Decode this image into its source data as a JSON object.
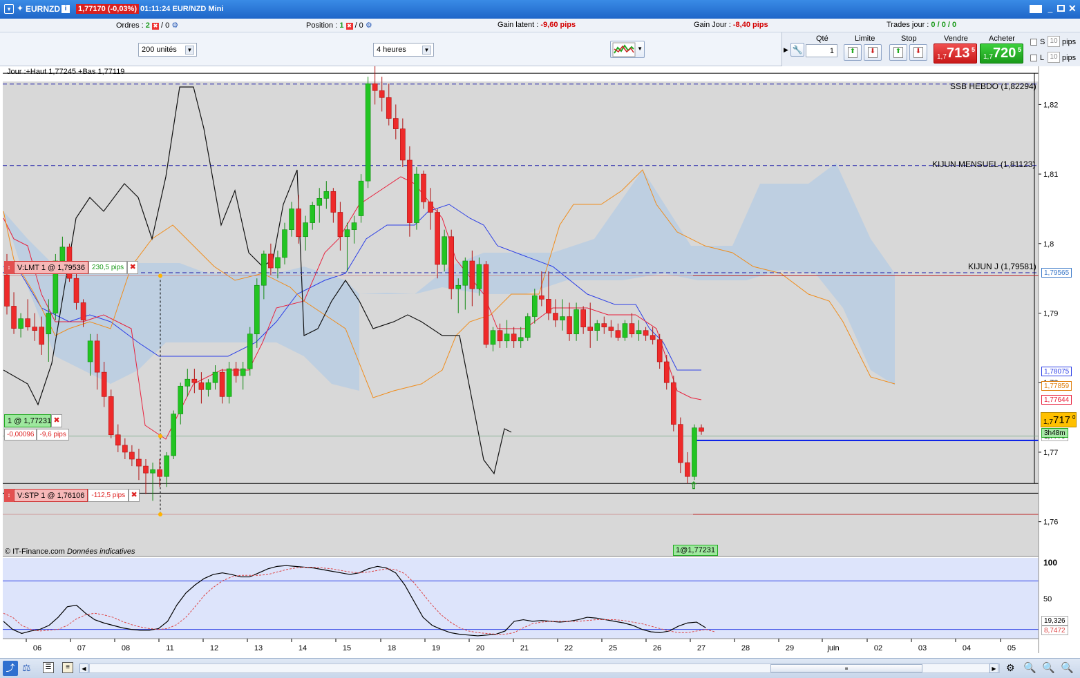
{
  "title": {
    "symbol": "EURNZD",
    "price_change": "1,77170 (-0,03%)",
    "clock_instrument": "01:11:24 EUR/NZD Mini"
  },
  "infobar": {
    "orders_label": "Ordres :",
    "orders_count": "2",
    "orders_sep": "/ 0",
    "position_label": "Position :",
    "position_count": "1",
    "position_sep": "/ 0",
    "latent_label": "Gain latent :",
    "latent_value": "-9,60 pips",
    "day_label": "Gain Jour :",
    "day_value": "-8,40 pips",
    "trades_label": "Trades jour :",
    "trades_value": "0 / 0 / 0"
  },
  "controls": {
    "units": "200 unités",
    "timeframe": "4 heures",
    "qty_label": "Qté",
    "qty_value": "1",
    "limit_label": "Limite",
    "stop_label": "Stop",
    "sell_label": "Vendre",
    "buy_label": "Acheter",
    "sell_price_small": "1,7",
    "sell_price_big": "713",
    "sell_price_sup": "5",
    "buy_price_small": "1,7",
    "buy_price_big": "720",
    "buy_price_sup": "5",
    "s_label": "S",
    "l_label": "L",
    "s_value": "10",
    "l_value": "10",
    "pips": "pips"
  },
  "chart": {
    "info": "Jour :+Haut 1,77245 +Bas 1,77119",
    "lines": {
      "ssb": "SSB HEBDO (1,82294)",
      "kijun_m": "KIJUN MENSUEL (1,81123)",
      "kijun_j": "KIJUN J (1,79581)"
    },
    "orders": {
      "lmt": {
        "label": "V:LMT  1 @ 1,79536",
        "pips": "230,5 pips"
      },
      "stp": {
        "label": "V:STP  1 @ 1,76106",
        "pips": "-112,5 pips"
      },
      "pos": {
        "label": "1 @ 1,77231",
        "pl": "-0,00096",
        "pips": "-9,6 pips"
      }
    },
    "fill_label": "1@1,77231",
    "timer": "3h48m",
    "source": "© IT-Finance.com",
    "source_note": "Données indicatives",
    "price_axis": [
      "1,82",
      "1,81",
      "1,8",
      "1,79",
      "1,78",
      "1,77",
      "1,76"
    ],
    "right_labels": {
      "l1": "1,79565",
      "l2": "1,78075",
      "l3": "1,77859",
      "l4": "1,77644",
      "cur_small": "1,7",
      "cur_big": "717",
      "cur_sup": "0",
      "l5": "1,7770"
    },
    "osc_axis": [
      "100",
      "50"
    ],
    "osc_labels": {
      "k": "19,326",
      "d": "8,7472"
    },
    "x_axis": [
      "06",
      "07",
      "08",
      "11",
      "12",
      "13",
      "14",
      "15",
      "18",
      "19",
      "20",
      "21",
      "22",
      "25",
      "26",
      "27",
      "28",
      "29",
      "juin",
      "02",
      "03",
      "04",
      "05"
    ],
    "colors": {
      "bull": "#22c422",
      "bear": "#ee2a2a",
      "tenkan": "#e8203c",
      "kijun": "#2b3ee6",
      "chikou": "#111111",
      "ssa": "#f08c1a",
      "ssb_cloud": "#6aa7e6"
    }
  },
  "chart_data": {
    "type": "candlestick",
    "symbol": "EURNZD",
    "timeframe": "4 heures",
    "ylim": [
      1.755,
      1.8255
    ],
    "candles": [
      [
        1.7955,
        1.7985,
        1.7898,
        1.791
      ],
      [
        1.791,
        1.793,
        1.787,
        1.7878
      ],
      [
        1.7878,
        1.79,
        1.7865,
        1.7892
      ],
      [
        1.7892,
        1.792,
        1.7875,
        1.788
      ],
      [
        1.788,
        1.79,
        1.786,
        1.7875
      ],
      [
        1.788,
        1.7895,
        1.784,
        1.7855
      ],
      [
        1.787,
        1.792,
        1.783,
        1.79
      ],
      [
        1.79,
        1.7985,
        1.789,
        1.7975
      ],
      [
        1.7975,
        1.801,
        1.796,
        1.7995
      ],
      [
        1.7995,
        1.8,
        1.7945,
        1.795
      ],
      [
        1.795,
        1.7965,
        1.7905,
        1.7915
      ],
      [
        1.7915,
        1.792,
        1.788,
        1.789
      ],
      [
        1.783,
        1.787,
        1.781,
        1.786
      ],
      [
        1.786,
        1.787,
        1.779,
        1.7815
      ],
      [
        1.7815,
        1.783,
        1.7765,
        1.778
      ],
      [
        1.778,
        1.779,
        1.772,
        1.7725
      ],
      [
        1.7725,
        1.774,
        1.77,
        1.771
      ],
      [
        1.771,
        1.772,
        1.769,
        1.77
      ],
      [
        1.77,
        1.771,
        1.768,
        1.769
      ],
      [
        1.769,
        1.7705,
        1.766,
        1.768
      ],
      [
        1.768,
        1.769,
        1.764,
        1.767
      ],
      [
        1.767,
        1.7685,
        1.763,
        1.7675
      ],
      [
        1.7675,
        1.769,
        1.765,
        1.7665
      ],
      [
        1.7665,
        1.77,
        1.765,
        1.7695
      ],
      [
        1.7695,
        1.776,
        1.769,
        1.7755
      ],
      [
        1.7755,
        1.78,
        1.774,
        1.7795
      ],
      [
        1.7795,
        1.782,
        1.778,
        1.7805
      ],
      [
        1.7805,
        1.782,
        1.7785,
        1.78
      ],
      [
        1.78,
        1.7815,
        1.777,
        1.779
      ],
      [
        1.779,
        1.7805,
        1.778,
        1.78
      ],
      [
        1.78,
        1.7825,
        1.779,
        1.7815
      ],
      [
        1.7815,
        1.782,
        1.777,
        1.778
      ],
      [
        1.778,
        1.783,
        1.777,
        1.782
      ],
      [
        1.782,
        1.783,
        1.78,
        1.781
      ],
      [
        1.781,
        1.783,
        1.779,
        1.782
      ],
      [
        1.782,
        1.788,
        1.781,
        1.787
      ],
      [
        1.787,
        1.795,
        1.785,
        1.794
      ],
      [
        1.794,
        1.799,
        1.792,
        1.7985
      ],
      [
        1.7985,
        1.8,
        1.7955,
        1.7965
      ],
      [
        1.7965,
        1.799,
        1.795,
        1.798
      ],
      [
        1.798,
        1.803,
        1.797,
        1.802
      ],
      [
        1.802,
        1.806,
        1.801,
        1.805
      ],
      [
        1.805,
        1.807,
        1.8,
        1.801
      ],
      [
        1.801,
        1.804,
        1.799,
        1.803
      ],
      [
        1.803,
        1.806,
        1.802,
        1.8055
      ],
      [
        1.8055,
        1.808,
        1.803,
        1.8065
      ],
      [
        1.8065,
        1.809,
        1.805,
        1.8075
      ],
      [
        1.8075,
        1.808,
        1.803,
        1.8045
      ],
      [
        1.8045,
        1.806,
        1.799,
        1.801
      ],
      [
        1.801,
        1.803,
        1.796,
        1.802
      ],
      [
        1.802,
        1.804,
        1.8,
        1.803
      ],
      [
        1.804,
        1.81,
        1.803,
        1.809
      ],
      [
        1.809,
        1.824,
        1.808,
        1.823
      ],
      [
        1.823,
        1.827,
        1.82,
        1.822
      ],
      [
        1.822,
        1.824,
        1.819,
        1.821
      ],
      [
        1.821,
        1.823,
        1.817,
        1.818
      ],
      [
        1.818,
        1.82,
        1.815,
        1.8165
      ],
      [
        1.8165,
        1.818,
        1.811,
        1.812
      ],
      [
        1.812,
        1.814,
        1.801,
        1.803
      ],
      [
        1.803,
        1.811,
        1.802,
        1.81
      ],
      [
        1.81,
        1.8105,
        1.805,
        1.806
      ],
      [
        1.806,
        1.808,
        1.802,
        1.8045
      ],
      [
        1.8045,
        1.805,
        1.795,
        1.797
      ],
      [
        1.797,
        1.802,
        1.796,
        1.801
      ],
      [
        1.801,
        1.802,
        1.792,
        1.7935
      ],
      [
        1.7935,
        1.795,
        1.79,
        1.794
      ],
      [
        1.794,
        1.798,
        1.7905,
        1.7975
      ],
      [
        1.7975,
        1.799,
        1.791,
        1.7935
      ],
      [
        1.7935,
        1.798,
        1.7925,
        1.797
      ],
      [
        1.797,
        1.7975,
        1.785,
        1.7855
      ],
      [
        1.7855,
        1.788,
        1.7845,
        1.7875
      ],
      [
        1.7875,
        1.7885,
        1.785,
        1.786
      ],
      [
        1.786,
        1.789,
        1.785,
        1.787
      ],
      [
        1.787,
        1.788,
        1.785,
        1.786
      ],
      [
        1.786,
        1.788,
        1.785,
        1.7865
      ],
      [
        1.7865,
        1.79,
        1.786,
        1.7895
      ],
      [
        1.7895,
        1.7935,
        1.7885,
        1.7925
      ],
      [
        1.7925,
        1.796,
        1.791,
        1.792
      ],
      [
        1.792,
        1.796,
        1.789,
        1.79
      ],
      [
        1.79,
        1.792,
        1.788,
        1.789
      ],
      [
        1.789,
        1.792,
        1.7875,
        1.7895
      ],
      [
        1.7895,
        1.7915,
        1.786,
        1.787
      ],
      [
        1.787,
        1.7915,
        1.786,
        1.7905
      ],
      [
        1.7905,
        1.791,
        1.787,
        1.788
      ],
      [
        1.788,
        1.7915,
        1.785,
        1.7875
      ],
      [
        1.7875,
        1.789,
        1.786,
        1.7885
      ],
      [
        1.7885,
        1.7895,
        1.787,
        1.788
      ],
      [
        1.788,
        1.789,
        1.7865,
        1.7875
      ],
      [
        1.7875,
        1.7885,
        1.786,
        1.7865
      ],
      [
        1.7865,
        1.789,
        1.786,
        1.7885
      ],
      [
        1.7885,
        1.79,
        1.7865,
        1.787
      ],
      [
        1.787,
        1.789,
        1.786,
        1.7875
      ],
      [
        1.7875,
        1.788,
        1.786,
        1.7868
      ],
      [
        1.7868,
        1.788,
        1.7855,
        1.7862
      ],
      [
        1.7862,
        1.787,
        1.782,
        1.783
      ],
      [
        1.783,
        1.784,
        1.779,
        1.78
      ],
      [
        1.78,
        1.781,
        1.773,
        1.774
      ],
      [
        1.774,
        1.775,
        1.767,
        1.7685
      ],
      [
        1.7685,
        1.77,
        1.7655,
        1.7665
      ],
      [
        1.7665,
        1.774,
        1.766,
        1.7735
      ],
      [
        1.7735,
        1.774,
        1.7725,
        1.773
      ]
    ],
    "tenkan": [
      1.7985,
      1.7975,
      1.796,
      1.795,
      1.7935,
      1.792,
      1.791,
      1.79,
      1.7895,
      1.788,
      1.786,
      1.784,
      1.783,
      1.782,
      1.78,
      1.778,
      1.776,
      1.7745,
      1.774,
      1.7745,
      1.775,
      1.776,
      1.7775,
      1.779,
      1.78,
      1.781,
      1.782,
      1.783,
      1.785,
      1.79,
      1.793,
      1.795,
      1.798,
      1.801,
      1.804,
      1.8055,
      1.807,
      1.809,
      1.81,
      1.8105,
      1.813,
      1.8155,
      1.8155,
      1.815,
      1.814,
      1.81,
      1.807,
      1.804,
      1.8,
      1.797,
      1.793,
      1.791,
      1.79,
      1.7895,
      1.7895,
      1.789,
      1.7885,
      1.788,
      1.7878,
      1.7875,
      1.787,
      1.786,
      1.782,
      1.78,
      1.779
    ],
    "ssb_levels": {
      "SSB HEBDO": 1.82294,
      "KIJUN MENSUEL": 1.81123,
      "KIJUN J": 1.79581
    },
    "orders": {
      "limit_sell": 1.79536,
      "stop_sell": 1.76106,
      "position": 1.77231
    },
    "current": {
      "bid": 1.77135,
      "ask": 1.77205,
      "last": 1.7717
    },
    "osc_ylim": [
      0,
      100
    ],
    "osc_levels": [
      80,
      20
    ],
    "osc_k": [
      30,
      20,
      15,
      18,
      20,
      25,
      35,
      48,
      50,
      40,
      32,
      28,
      25,
      22,
      20,
      19,
      19,
      21,
      30,
      50,
      65,
      75,
      83,
      88,
      90,
      88,
      85,
      85,
      90,
      95,
      98,
      99,
      98,
      97,
      96,
      94,
      92,
      90,
      88,
      90,
      95,
      98,
      96,
      90,
      75,
      55,
      35,
      25,
      20,
      16,
      14,
      13,
      12,
      13,
      14,
      18,
      30,
      32,
      30,
      31,
      30,
      29,
      30,
      32,
      35,
      34,
      32,
      30,
      28,
      25,
      20,
      17,
      16,
      18,
      24,
      28,
      29,
      22
    ],
    "osc_d": [
      40,
      35,
      25,
      20,
      18,
      19,
      20,
      25,
      33,
      38,
      40,
      38,
      35,
      30,
      26,
      23,
      21,
      20,
      21,
      26,
      35,
      48,
      62,
      72,
      80,
      85,
      87,
      87,
      87,
      88,
      91,
      94,
      96,
      97,
      97,
      96,
      95,
      93,
      91,
      90,
      91,
      93,
      95,
      94,
      89,
      78,
      64,
      50,
      38,
      29,
      22,
      18,
      16,
      15,
      14,
      14,
      16,
      22,
      27,
      29,
      30,
      30,
      30,
      30,
      31,
      32,
      32,
      32,
      31,
      29,
      27,
      24,
      21,
      18,
      16,
      16,
      18,
      20,
      17
    ],
    "x_labels": [
      "06",
      "07",
      "08",
      "11",
      "12",
      "13",
      "14",
      "15",
      "18",
      "19",
      "20",
      "21",
      "22",
      "25",
      "26",
      "27",
      "28",
      "29",
      "juin",
      "02",
      "03",
      "04",
      "05"
    ]
  }
}
